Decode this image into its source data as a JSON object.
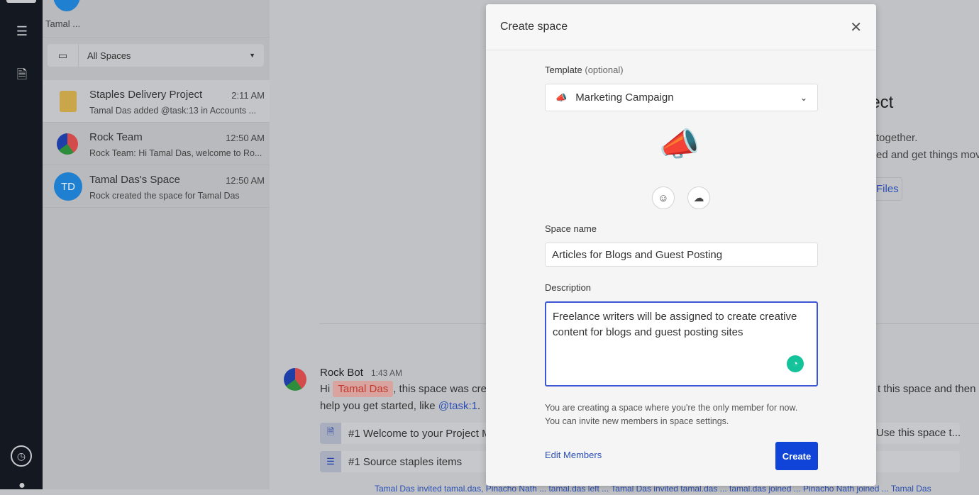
{
  "current_user": {
    "name": "Tamal ..."
  },
  "filter": {
    "label": "All Spaces"
  },
  "spaces": [
    {
      "title": "Staples Delivery Project",
      "time": "2:11 AM",
      "snippet": "Tamal Das added @task:13 in Accounts ...",
      "avatar": ""
    },
    {
      "title": "Rock Team",
      "time": "12:50 AM",
      "snippet": "Rock Team: Hi Tamal Das, welcome to Ro...",
      "avatar": ""
    },
    {
      "title": "Tamal Das's Space",
      "time": "12:50 AM",
      "snippet": "Rock created the space for Tamal Das",
      "avatar": "TD"
    }
  ],
  "background": {
    "title_fragment": "ject",
    "line1": "together.",
    "line2": "ed and get things mov",
    "files_button": "Files",
    "message": {
      "author": "Rock Bot",
      "time": "1:43 AM",
      "greeting": "Hi",
      "mention": "Tamal Das",
      "text1": ", this space was cre",
      "text_right": "t this space and then c",
      "text2": "help you get started, like ",
      "task_link": "@task:1",
      "text2_end": "."
    },
    "cards": [
      {
        "text": "#1 Welcome to your Project M",
        "right": "Use this space t..."
      },
      {
        "text": "#1 Source staples items",
        "right": ""
      }
    ],
    "activity": "Tamal Das invited tamal.das, Pinacho Nath ... tamal.das left ... Tamal Das invited tamal.das ... tamal.das joined ... Pinacho Nath joined ... Tamal Das"
  },
  "modal": {
    "title": "Create space",
    "template_label": "Template",
    "template_optional": "(optional)",
    "template_value": "Marketing Campaign",
    "template_emoji": "📣",
    "space_name_label": "Space name",
    "space_name_value": "Articles for Blogs and Guest Posting",
    "description_label": "Description",
    "description_value": "Freelance writers will be assigned to create creative content for blogs and guest posting sites",
    "note_line1": "You are creating a space where you're the only member for now.",
    "note_line2": "You can invite new members in space settings.",
    "edit_members": "Edit Members",
    "create": "Create"
  },
  "colors": {
    "accent": "#1044d8",
    "link": "#2b4fb5",
    "mention": "#c0392b",
    "grammarly": "#15c39a"
  }
}
